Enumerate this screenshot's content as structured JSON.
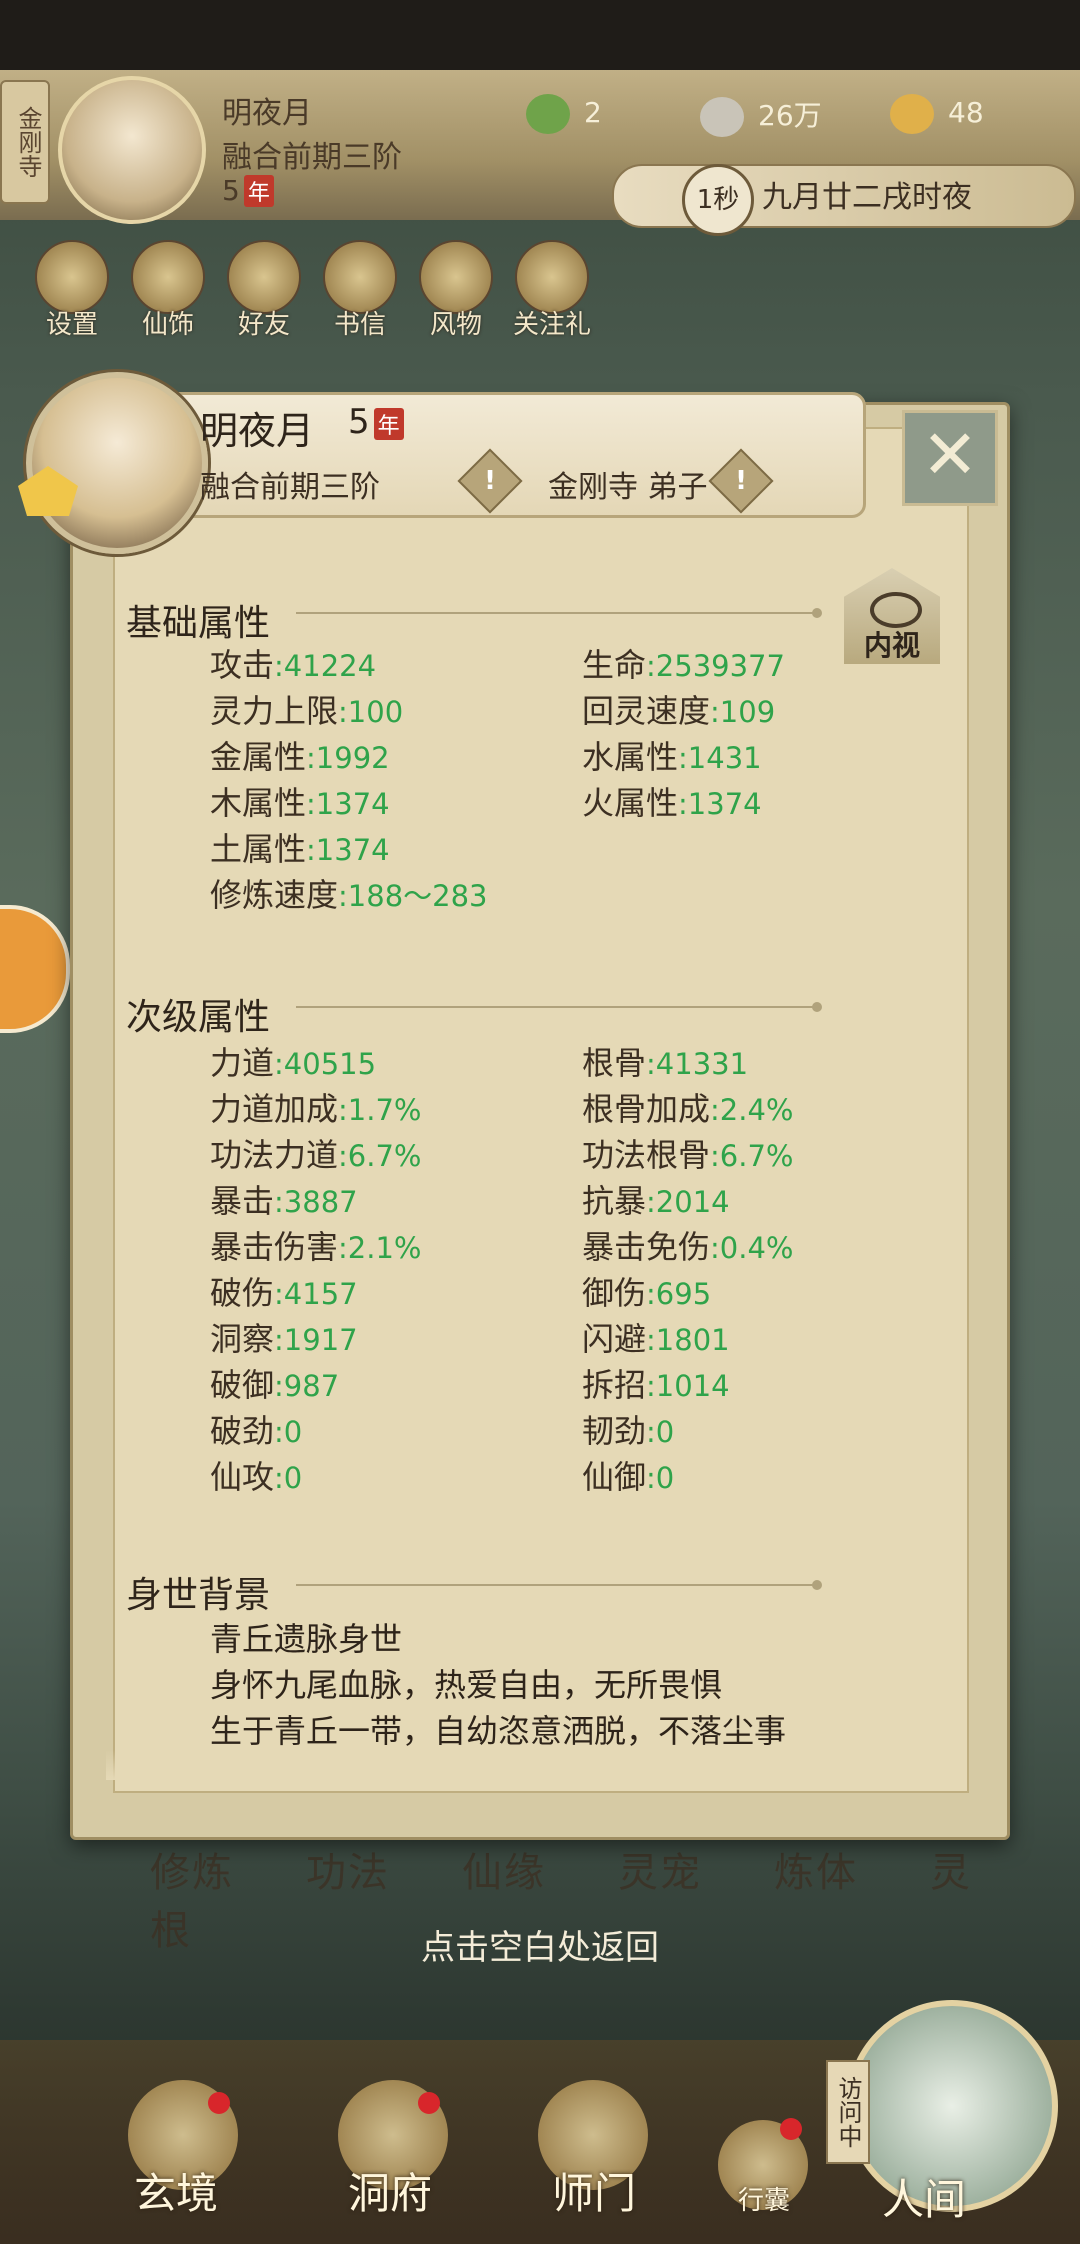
{
  "hud": {
    "sect": "金刚寺",
    "name": "明夜月",
    "stage": "融合前期三阶",
    "age": "5",
    "age_badge": "年",
    "res_leaf": "2",
    "res_coin": "26万",
    "res_power": "48",
    "time_speed": "1秒",
    "time_text": "九月廿二戌时夜"
  },
  "menu": [
    "设置",
    "仙饰",
    "好友",
    "书信",
    "风物",
    "关注礼"
  ],
  "dialog": {
    "name": "明夜月",
    "age": "5",
    "age_badge": "年",
    "stage": "融合前期三阶",
    "sect": "金刚寺 弟子",
    "eye_label": "内视"
  },
  "basic": {
    "title": "基础属性",
    "rows": [
      {
        "l": "攻击",
        "v": "41224"
      },
      {
        "l": "生命",
        "v": "2539377"
      },
      {
        "l": "灵力上限",
        "v": "100"
      },
      {
        "l": "回灵速度",
        "v": "109"
      },
      {
        "l": "金属性",
        "v": "1992"
      },
      {
        "l": "水属性",
        "v": "1431"
      },
      {
        "l": "木属性",
        "v": "1374"
      },
      {
        "l": "火属性",
        "v": "1374"
      },
      {
        "l": "土属性",
        "v": "1374"
      },
      {
        "l": "修炼速度",
        "v": "188～283"
      }
    ]
  },
  "secondary": {
    "title": "次级属性",
    "rows": [
      {
        "l": "力道",
        "v": "40515"
      },
      {
        "l": "根骨",
        "v": "41331"
      },
      {
        "l": "力道加成",
        "v": "1.7%"
      },
      {
        "l": "根骨加成",
        "v": "2.4%"
      },
      {
        "l": "功法力道",
        "v": "6.7%"
      },
      {
        "l": "功法根骨",
        "v": "6.7%"
      },
      {
        "l": "暴击",
        "v": "3887"
      },
      {
        "l": "抗暴",
        "v": "2014"
      },
      {
        "l": "暴击伤害",
        "v": "2.1%"
      },
      {
        "l": "暴击免伤",
        "v": "0.4%"
      },
      {
        "l": "破伤",
        "v": "4157"
      },
      {
        "l": "御伤",
        "v": "695"
      },
      {
        "l": "洞察",
        "v": "1917"
      },
      {
        "l": "闪避",
        "v": "1801"
      },
      {
        "l": "破御",
        "v": "987"
      },
      {
        "l": "拆招",
        "v": "1014"
      },
      {
        "l": "破劲",
        "v": "0"
      },
      {
        "l": "韧劲",
        "v": "0"
      },
      {
        "l": "仙攻",
        "v": "0"
      },
      {
        "l": "仙御",
        "v": "0"
      }
    ]
  },
  "background": {
    "title": "身世背景",
    "lines": [
      "青丘遗脉身世",
      "身怀九尾血脉，热爱自由，无所畏惧",
      "生于青丘一带，自幼恣意洒脱，不落尘事"
    ]
  },
  "cult_tabs": [
    "修炼",
    "功法",
    "仙缘",
    "灵宠",
    "炼体",
    "灵根"
  ],
  "return_hint": "点击空白处返回",
  "nav": [
    "玄境",
    "洞府",
    "师门",
    "行囊",
    "人间"
  ],
  "visit_tag": "访问中"
}
